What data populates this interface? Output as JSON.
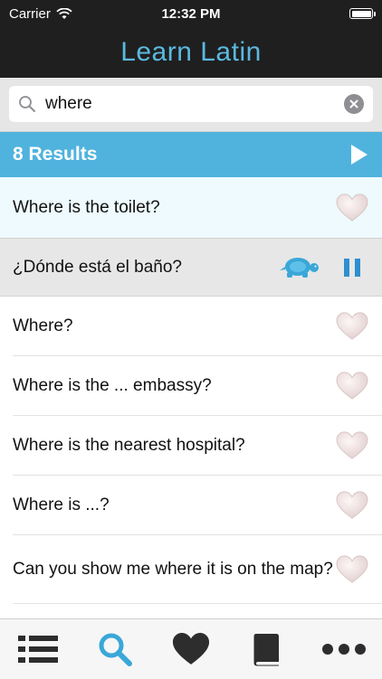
{
  "status": {
    "carrier": "Carrier",
    "time": "12:32 PM"
  },
  "app": {
    "title": "Learn Latin"
  },
  "search": {
    "query": "where"
  },
  "results": {
    "label": "8 Results"
  },
  "rows": [
    {
      "text": "Where is the toilet?"
    },
    {
      "text": "¿Dónde está el baño?"
    },
    {
      "text": "Where?"
    },
    {
      "text": "Where is the ... embassy?"
    },
    {
      "text": "Where is the nearest hospital?"
    },
    {
      "text": "Where is ...?"
    },
    {
      "text": "Can you show me where it is on the map?"
    }
  ],
  "tabs": [
    {
      "icon": "list-icon"
    },
    {
      "icon": "search-icon"
    },
    {
      "icon": "heart-icon"
    },
    {
      "icon": "book-icon"
    },
    {
      "icon": "more-icon"
    }
  ],
  "colors": {
    "accent": "#4fb3de",
    "title": "#5ab9e0",
    "highlight_row": "#eefafd",
    "translation_row": "#e7e7e7",
    "tab_icon": "#2d2d2d",
    "active_tab_icon": "#3aa7d8"
  }
}
